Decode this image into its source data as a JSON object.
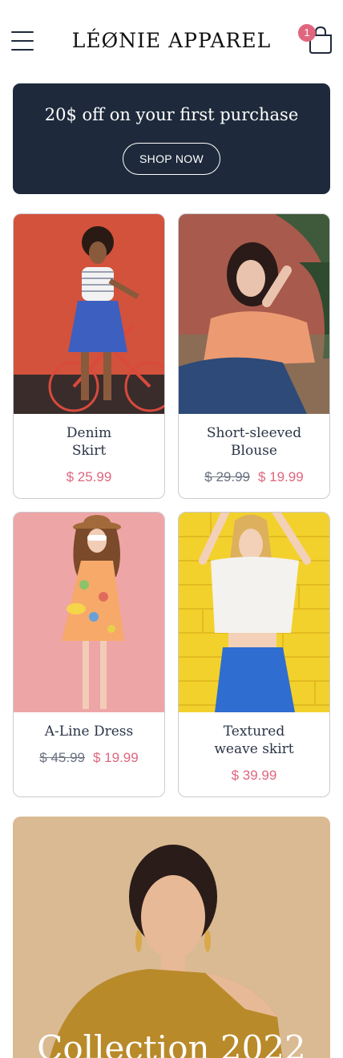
{
  "brand": {
    "name": "LÉØNIE APPAREL"
  },
  "cart": {
    "count": "1"
  },
  "promo": {
    "title": "20$ off on your first purchase",
    "button_label": "SHOP NOW"
  },
  "products": [
    {
      "name": "Denim\nSkirt",
      "old_price": "",
      "price": "$ 25.99",
      "image": "woman-with-red-bicycle"
    },
    {
      "name": "Short-sleeved\nBlouse",
      "old_price": "$ 29.99",
      "price": "$ 19.99",
      "image": "woman-peach-blouse"
    },
    {
      "name": "A-Line Dress",
      "old_price": "$ 45.99",
      "price": "$ 19.99",
      "image": "woman-floral-dress"
    },
    {
      "name": "Textured\nweave skirt",
      "old_price": "",
      "price": "$ 39.99",
      "image": "woman-blue-skirt-yellow-wall"
    }
  ],
  "collection": {
    "title": "Collection 2022",
    "image": "woman-mustard-sweater"
  },
  "colors": {
    "navy": "#1e2a3b",
    "accent": "#e0667e",
    "border": "#c9ccd2"
  }
}
